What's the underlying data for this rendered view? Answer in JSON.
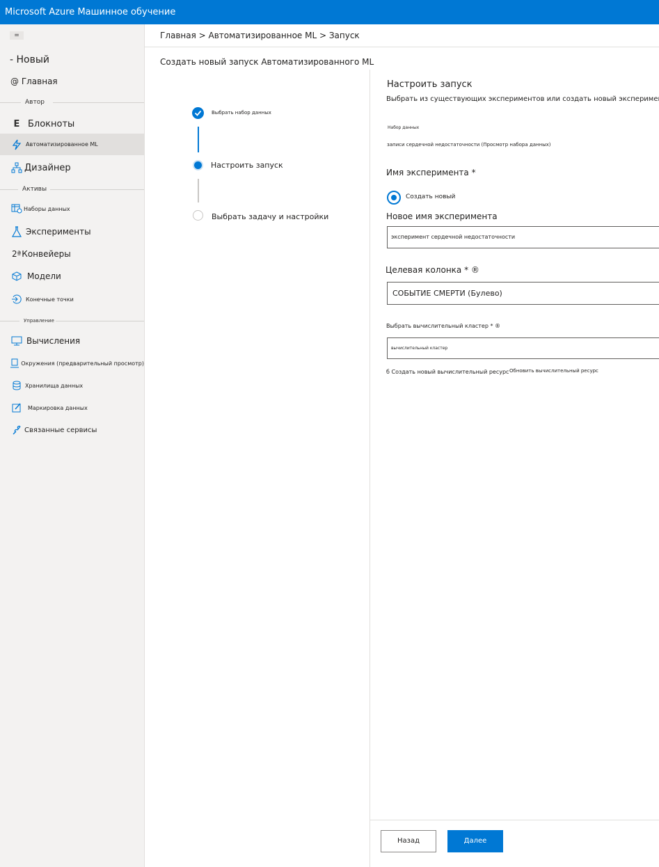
{
  "app": {
    "title": "Microsoft Azure Машинное обучение"
  },
  "sidebar": {
    "menu_glyph": "=",
    "new_label": "- Новый",
    "home_label": "@ Главная",
    "sections": {
      "author": "Автор",
      "assets": "Активы",
      "manage": "Управление"
    },
    "items": {
      "notebooks": "Блокноты",
      "automl": "Автоматизированное ML",
      "designer": "Дизайнер",
      "datasets": "Наборы данных",
      "experiments": "Эксперименты",
      "pipelines": "Конвейеры",
      "pipelines_prefix": "2ª",
      "models": "Модели",
      "endpoints": "Конечные точки",
      "compute": "Вычисления",
      "environments": "Окружения (предварительный просмотр)",
      "datastores": "Хранилища данных",
      "labeling": "Маркировка данных",
      "linked": "Связанные сервисы"
    }
  },
  "breadcrumb": "Главная > Автоматизированное ML > Запуск",
  "page_title": "Создать новый запуск Автоматизированного ML",
  "wizard": {
    "steps": [
      {
        "label": "Выбрать набор данных",
        "state": "done"
      },
      {
        "label": "Настроить запуск",
        "state": "current"
      },
      {
        "label": "Выбрать задачу и настройки",
        "state": "pending"
      }
    ]
  },
  "panel": {
    "title": "Настроить запуск",
    "description": "Выбрать из существующих экспериментов или создать новый эксперимент, thr",
    "dataset_label": "Набор данных",
    "dataset_value": "записи сердечной недостаточности (Просмотр набора данных)",
    "experiment_name_label": "Имя эксперимента *",
    "radio_create_new": "Создать новый",
    "new_experiment_label": "Новое имя эксперимента",
    "new_experiment_value": "эксперимент сердечной недостаточности",
    "target_column_label": "Целевая колонка * ®",
    "target_column_value": "СОБЫТИЕ СМЕРТИ (Булево)",
    "compute_label": "Выбрать вычислительный кластер * ®",
    "compute_value": "вычислительный кластер",
    "create_compute_link": "б Создать новый вычислительный ресурс",
    "refresh_compute_link": "Обновить вычислительный ресурс"
  },
  "footer": {
    "back_label": "Назад",
    "next_label": "Далее"
  },
  "colors": {
    "accent": "#0078d4",
    "sidebar_bg": "#f3f2f1"
  }
}
